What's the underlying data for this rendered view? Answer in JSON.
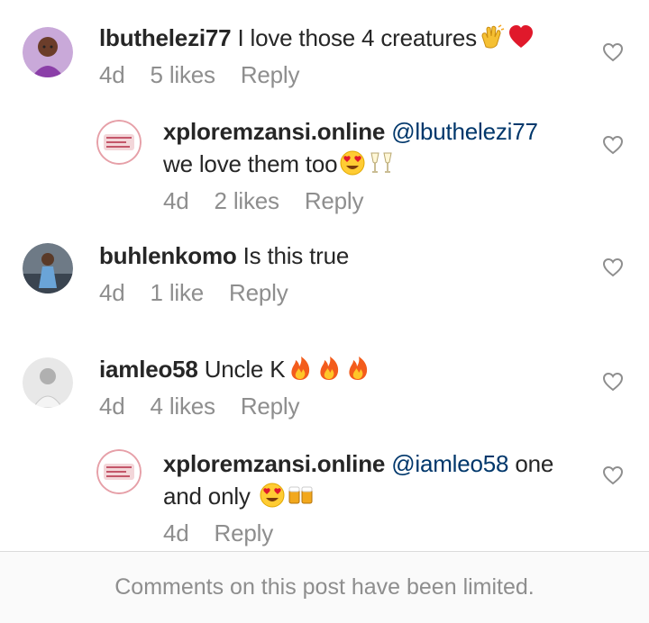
{
  "comments": [
    {
      "username": "lbuthelezi77",
      "text": "I love those 4 creatures",
      "emojis": [
        "clapping-hands",
        "red-heart"
      ],
      "time": "4d",
      "likes": "5 likes",
      "reply": "Reply"
    },
    {
      "username": "xploremzansi.online",
      "mention": "@lbuthelezi77",
      "text": "we love them too",
      "emojis": [
        "heart-eyes",
        "clinking-glasses"
      ],
      "time": "4d",
      "likes": "2 likes",
      "reply": "Reply"
    },
    {
      "username": "buhlenkomo",
      "text": "Is this true",
      "time": "4d",
      "likes": "1 like",
      "reply": "Reply"
    },
    {
      "username": "iamleo58",
      "text": "Uncle K",
      "emojis": [
        "fire",
        "fire",
        "fire"
      ],
      "time": "4d",
      "likes": "4 likes",
      "reply": "Reply"
    },
    {
      "username": "xploremzansi.online",
      "mention": "@iamleo58",
      "text": "one and only",
      "emojis": [
        "heart-eyes",
        "clinking-beer-mugs"
      ],
      "time": "4d",
      "reply": "Reply"
    }
  ],
  "footer": {
    "message": "Comments on this post have been limited."
  },
  "colors": {
    "username": "#262626",
    "mention": "#00376b",
    "meta": "#8e8e8e",
    "footer_bg": "#fafafa"
  }
}
